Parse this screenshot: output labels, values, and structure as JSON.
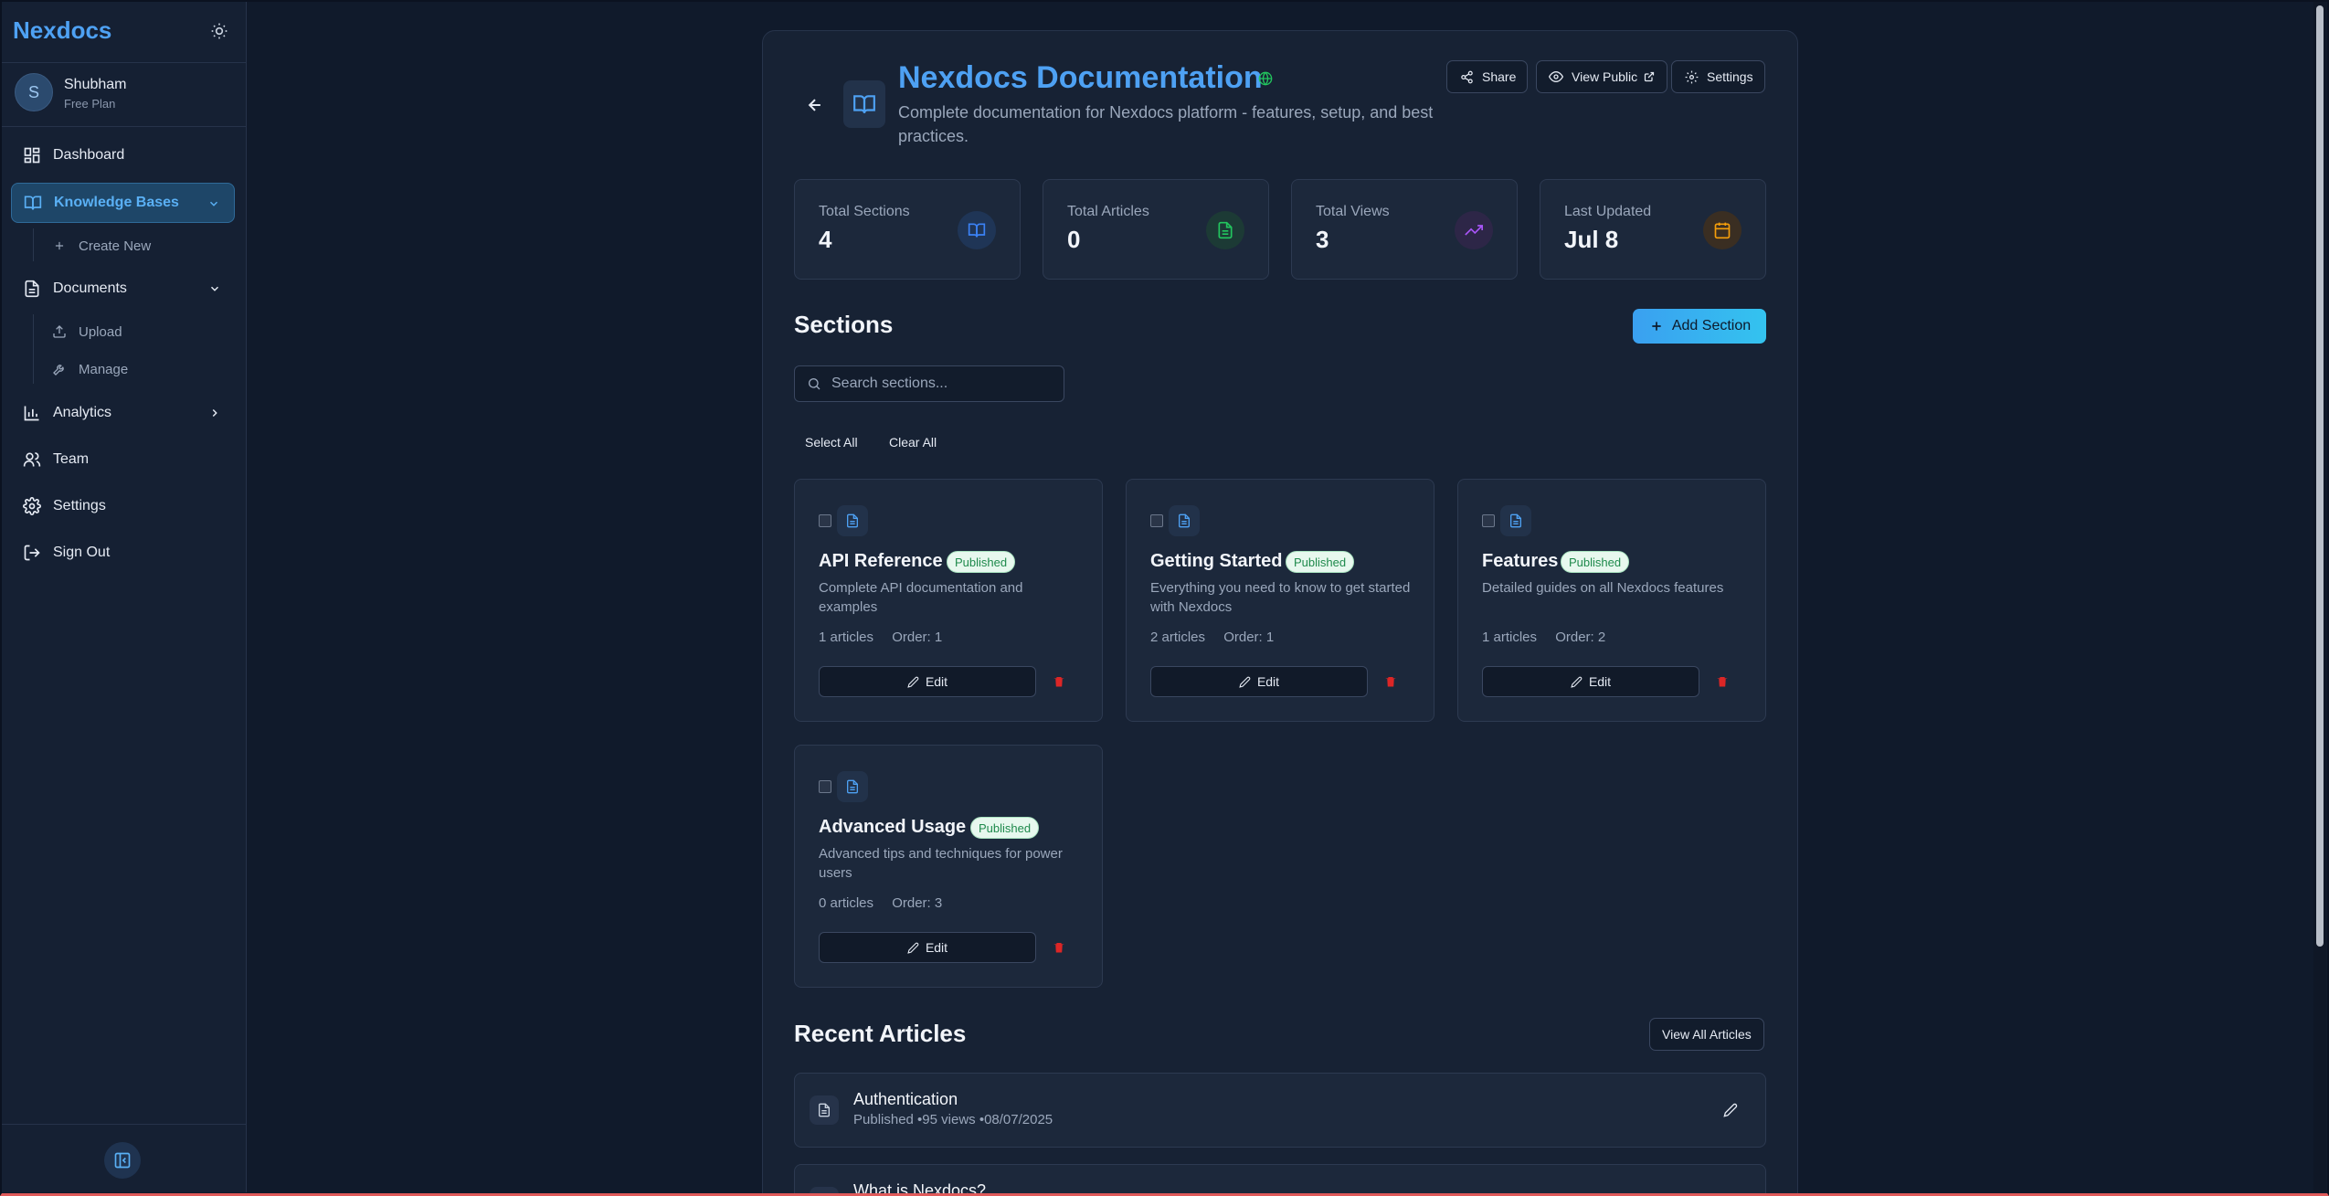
{
  "sidebar": {
    "brand": "Nexdocs",
    "user": {
      "initial": "S",
      "name": "Shubham",
      "plan": "Free Plan"
    },
    "nav": {
      "dashboard": "Dashboard",
      "knowledge_bases": "Knowledge Bases",
      "create_new": "Create New",
      "documents": "Documents",
      "upload": "Upload",
      "manage": "Manage",
      "analytics": "Analytics",
      "team": "Team",
      "settings": "Settings",
      "sign_out": "Sign Out"
    }
  },
  "header": {
    "title": "Nexdocs Documentation",
    "description": "Complete documentation for Nexdocs platform - features, setup, and best practices.",
    "buttons": {
      "share": "Share",
      "view_public": "View Public",
      "settings": "Settings"
    }
  },
  "stats": [
    {
      "label": "Total Sections",
      "value": "4",
      "icon": "book-icon",
      "color": "#3b82f6"
    },
    {
      "label": "Total Articles",
      "value": "0",
      "icon": "file-icon",
      "color": "#22c55e"
    },
    {
      "label": "Total Views",
      "value": "3",
      "icon": "trending-up-icon",
      "color": "#a855f7"
    },
    {
      "label": "Last Updated",
      "value": "Jul 8",
      "icon": "calendar-icon",
      "color": "#f59e0b"
    }
  ],
  "sections": {
    "title": "Sections",
    "add_button": "Add Section",
    "search_placeholder": "Search sections...",
    "select_all": "Select All",
    "clear_all": "Clear All",
    "edit_label": "Edit",
    "items": [
      {
        "name": "API Reference",
        "status": "Published",
        "description": "Complete API documentation and examples",
        "articles": "1 articles",
        "order": "Order: 1"
      },
      {
        "name": "Getting Started",
        "status": "Published",
        "description": "Everything you need to know to get started with Nexdocs",
        "articles": "2 articles",
        "order": "Order: 1"
      },
      {
        "name": "Features",
        "status": "Published",
        "description": "Detailed guides on all Nexdocs features",
        "articles": "1 articles",
        "order": "Order: 2"
      },
      {
        "name": "Advanced Usage",
        "status": "Published",
        "description": "Advanced tips and techniques for power users",
        "articles": "0 articles",
        "order": "Order: 3"
      }
    ]
  },
  "recent_articles": {
    "title": "Recent Articles",
    "view_all": "View All Articles",
    "items": [
      {
        "title": "Authentication",
        "meta": "Published •95 views •08/07/2025"
      },
      {
        "title": "What is Nexdocs?",
        "meta": ""
      }
    ]
  },
  "colors": {
    "accent": "#4ea1f3",
    "background": "#101a2b",
    "published_text": "#1f8a4c",
    "delete": "#dc2626"
  }
}
